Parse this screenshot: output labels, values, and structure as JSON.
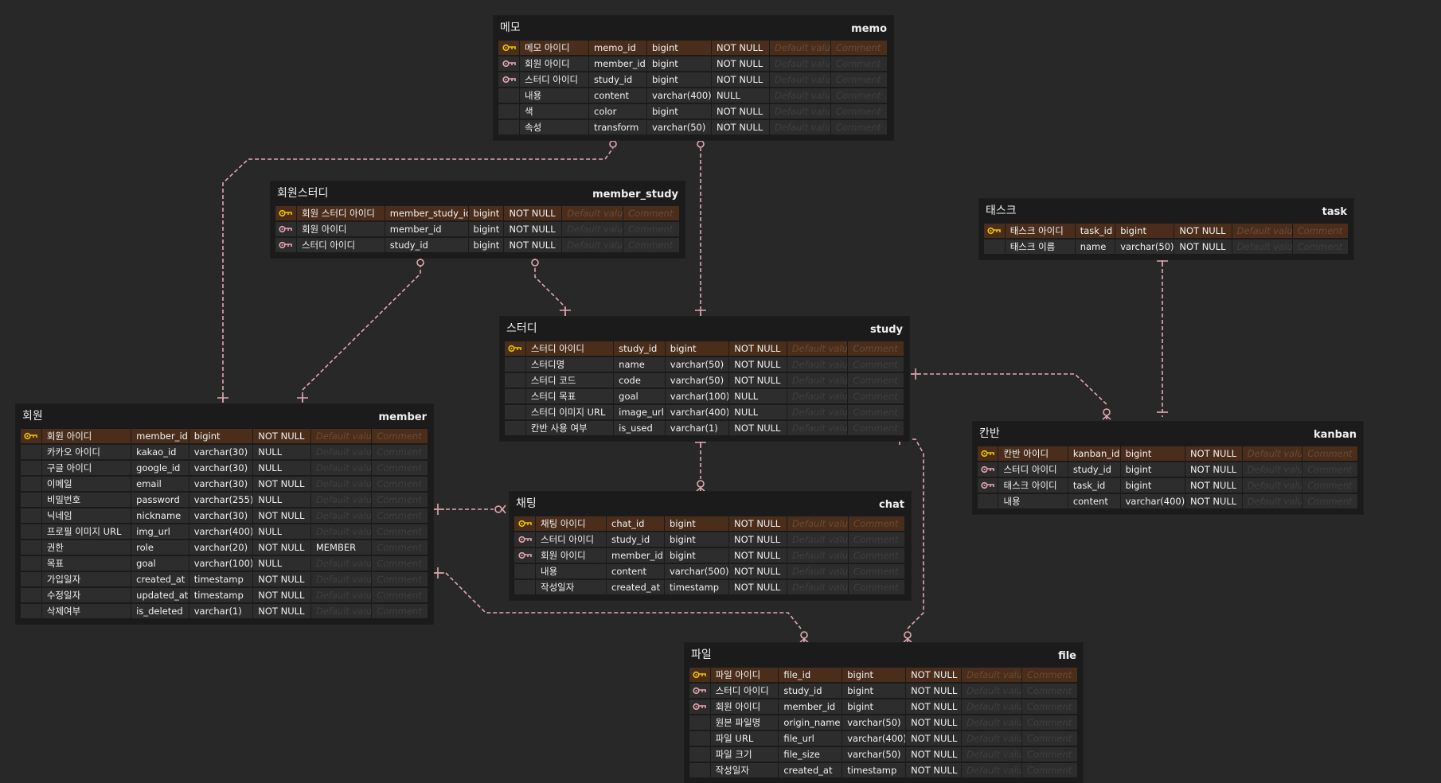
{
  "colors": {
    "background": "#282828",
    "table_bg": "#1b1b1b",
    "cell_bg": "#2d2d2d",
    "pk_row_bg": "#4a2e1b",
    "pk_key": "#f0c400",
    "fk_key": "#e8a5b4",
    "relation_line": "#e0a9b2"
  },
  "placeholders": {
    "default_value": "Default value",
    "comment": "Comment"
  },
  "tables": {
    "memo": {
      "logical": "메모",
      "physical": "memo",
      "columns": [
        {
          "key": "pk",
          "logical": "메모 아이디",
          "physical": "memo_id",
          "type": "bigint",
          "nullable": "NOT NULL",
          "default": "",
          "comment": ""
        },
        {
          "key": "fk",
          "logical": "회원 아이디",
          "physical": "member_id",
          "type": "bigint",
          "nullable": "NOT NULL",
          "default": "",
          "comment": ""
        },
        {
          "key": "fk",
          "logical": "스터디 아이디",
          "physical": "study_id",
          "type": "bigint",
          "nullable": "NOT NULL",
          "default": "",
          "comment": ""
        },
        {
          "key": "",
          "logical": "내용",
          "physical": "content",
          "type": "varchar(400)",
          "nullable": "NULL",
          "default": "",
          "comment": ""
        },
        {
          "key": "",
          "logical": "색",
          "physical": "color",
          "type": "bigint",
          "nullable": "NOT NULL",
          "default": "",
          "comment": ""
        },
        {
          "key": "",
          "logical": "속성",
          "physical": "transform",
          "type": "varchar(50)",
          "nullable": "NOT NULL",
          "default": "",
          "comment": ""
        }
      ]
    },
    "member_study": {
      "logical": "회원스터디",
      "physical": "member_study",
      "columns": [
        {
          "key": "pk",
          "logical": "회원 스터디 아이디",
          "physical": "member_study_id",
          "type": "bigint",
          "nullable": "NOT NULL",
          "default": "",
          "comment": ""
        },
        {
          "key": "fk",
          "logical": "회원 아이디",
          "physical": "member_id",
          "type": "bigint",
          "nullable": "NOT NULL",
          "default": "",
          "comment": ""
        },
        {
          "key": "fk",
          "logical": "스터디 아이디",
          "physical": "study_id",
          "type": "bigint",
          "nullable": "NOT NULL",
          "default": "",
          "comment": ""
        }
      ]
    },
    "study": {
      "logical": "스터디",
      "physical": "study",
      "columns": [
        {
          "key": "pk",
          "logical": "스터디 아이디",
          "physical": "study_id",
          "type": "bigint",
          "nullable": "NOT NULL",
          "default": "",
          "comment": ""
        },
        {
          "key": "",
          "logical": "스터디명",
          "physical": "name",
          "type": "varchar(50)",
          "nullable": "NOT NULL",
          "default": "",
          "comment": ""
        },
        {
          "key": "",
          "logical": "스터디 코드",
          "physical": "code",
          "type": "varchar(50)",
          "nullable": "NOT NULL",
          "default": "",
          "comment": ""
        },
        {
          "key": "",
          "logical": "스터디 목표",
          "physical": "goal",
          "type": "varchar(100)",
          "nullable": "NULL",
          "default": "",
          "comment": ""
        },
        {
          "key": "",
          "logical": "스터디 이미지 URL",
          "physical": "image_url",
          "type": "varchar(400)",
          "nullable": "NULL",
          "default": "",
          "comment": ""
        },
        {
          "key": "",
          "logical": "칸반 사용 여부",
          "physical": "is_used",
          "type": "varchar(1)",
          "nullable": "NOT NULL",
          "default": "",
          "comment": ""
        }
      ]
    },
    "member": {
      "logical": "회원",
      "physical": "member",
      "columns": [
        {
          "key": "pk",
          "logical": "회원 아이디",
          "physical": "member_id",
          "type": "bigint",
          "nullable": "NOT NULL",
          "default": "",
          "comment": ""
        },
        {
          "key": "",
          "logical": "카카오 아이디",
          "physical": "kakao_id",
          "type": "varchar(30)",
          "nullable": "NULL",
          "default": "",
          "comment": ""
        },
        {
          "key": "",
          "logical": "구글 아이디",
          "physical": "google_id",
          "type": "varchar(30)",
          "nullable": "NULL",
          "default": "",
          "comment": ""
        },
        {
          "key": "",
          "logical": "이메일",
          "physical": "email",
          "type": "varchar(30)",
          "nullable": "NOT NULL",
          "default": "",
          "comment": ""
        },
        {
          "key": "",
          "logical": "비밀번호",
          "physical": "password",
          "type": "varchar(255)",
          "nullable": "NULL",
          "default": "",
          "comment": ""
        },
        {
          "key": "",
          "logical": "닉네임",
          "physical": "nickname",
          "type": "varchar(30)",
          "nullable": "NOT NULL",
          "default": "",
          "comment": ""
        },
        {
          "key": "",
          "logical": "프로필 이미지 URL",
          "physical": "img_url",
          "type": "varchar(400)",
          "nullable": "NULL",
          "default": "",
          "comment": ""
        },
        {
          "key": "",
          "logical": "권한",
          "physical": "role",
          "type": "varchar(20)",
          "nullable": "NOT NULL",
          "default": "MEMBER",
          "comment": ""
        },
        {
          "key": "",
          "logical": "목표",
          "physical": "goal",
          "type": "varchar(100)",
          "nullable": "NULL",
          "default": "",
          "comment": ""
        },
        {
          "key": "",
          "logical": "가입일자",
          "physical": "created_at",
          "type": "timestamp",
          "nullable": "NOT NULL",
          "default": "",
          "comment": ""
        },
        {
          "key": "",
          "logical": "수정일자",
          "physical": "updated_at",
          "type": "timestamp",
          "nullable": "NOT NULL",
          "default": "",
          "comment": ""
        },
        {
          "key": "",
          "logical": "삭제여부",
          "physical": "is_deleted",
          "type": "varchar(1)",
          "nullable": "NOT NULL",
          "default": "",
          "comment": ""
        }
      ]
    },
    "chat": {
      "logical": "채팅",
      "physical": "chat",
      "columns": [
        {
          "key": "pk",
          "logical": "채팅 아이디",
          "physical": "chat_id",
          "type": "bigint",
          "nullable": "NOT NULL",
          "default": "",
          "comment": ""
        },
        {
          "key": "fk",
          "logical": "스터디 아이디",
          "physical": "study_id",
          "type": "bigint",
          "nullable": "NOT NULL",
          "default": "",
          "comment": ""
        },
        {
          "key": "fk",
          "logical": "회원 아이디",
          "physical": "member_id",
          "type": "bigint",
          "nullable": "NOT NULL",
          "default": "",
          "comment": ""
        },
        {
          "key": "",
          "logical": "내용",
          "physical": "content",
          "type": "varchar(500)",
          "nullable": "NOT NULL",
          "default": "",
          "comment": ""
        },
        {
          "key": "",
          "logical": "작성일자",
          "physical": "created_at",
          "type": "timestamp",
          "nullable": "NOT NULL",
          "default": "",
          "comment": ""
        }
      ]
    },
    "file": {
      "logical": "파일",
      "physical": "file",
      "columns": [
        {
          "key": "pk",
          "logical": "파일 아이디",
          "physical": "file_id",
          "type": "bigint",
          "nullable": "NOT NULL",
          "default": "",
          "comment": ""
        },
        {
          "key": "fk",
          "logical": "스터디 아이디",
          "physical": "study_id",
          "type": "bigint",
          "nullable": "NOT NULL",
          "default": "",
          "comment": ""
        },
        {
          "key": "fk",
          "logical": "회원 아이디",
          "physical": "member_id",
          "type": "bigint",
          "nullable": "NOT NULL",
          "default": "",
          "comment": ""
        },
        {
          "key": "",
          "logical": "원본 파일명",
          "physical": "origin_name",
          "type": "varchar(50)",
          "nullable": "NOT NULL",
          "default": "",
          "comment": ""
        },
        {
          "key": "",
          "logical": "파일 URL",
          "physical": "file_url",
          "type": "varchar(400)",
          "nullable": "NOT NULL",
          "default": "",
          "comment": ""
        },
        {
          "key": "",
          "logical": "파일 크기",
          "physical": "file_size",
          "type": "varchar(50)",
          "nullable": "NOT NULL",
          "default": "",
          "comment": ""
        },
        {
          "key": "",
          "logical": "작성일자",
          "physical": "created_at",
          "type": "timestamp",
          "nullable": "NOT NULL",
          "default": "",
          "comment": ""
        }
      ]
    },
    "task": {
      "logical": "태스크",
      "physical": "task",
      "columns": [
        {
          "key": "pk",
          "logical": "태스크 아이디",
          "physical": "task_id",
          "type": "bigint",
          "nullable": "NOT NULL",
          "default": "",
          "comment": ""
        },
        {
          "key": "",
          "logical": "태스크 이름",
          "physical": "name",
          "type": "varchar(50)",
          "nullable": "NOT NULL",
          "default": "",
          "comment": ""
        }
      ]
    },
    "kanban": {
      "logical": "칸반",
      "physical": "kanban",
      "columns": [
        {
          "key": "pk",
          "logical": "칸반 아이디",
          "physical": "kanban_id",
          "type": "bigint",
          "nullable": "NOT NULL",
          "default": "",
          "comment": ""
        },
        {
          "key": "fk",
          "logical": "스터디 아이디",
          "physical": "study_id",
          "type": "bigint",
          "nullable": "NOT NULL",
          "default": "",
          "comment": ""
        },
        {
          "key": "fk",
          "logical": "태스크 아이디",
          "physical": "task_id",
          "type": "bigint",
          "nullable": "NOT NULL",
          "default": "",
          "comment": ""
        },
        {
          "key": "",
          "logical": "내용",
          "physical": "content",
          "type": "varchar(400)",
          "nullable": "NOT NULL",
          "default": "",
          "comment": ""
        }
      ]
    }
  },
  "relationships": [
    {
      "from": "member",
      "to": "memo",
      "type": "one-to-zero-or-many"
    },
    {
      "from": "study",
      "to": "memo",
      "type": "one-to-zero-or-many"
    },
    {
      "from": "member",
      "to": "member_study",
      "type": "one-to-zero-or-many"
    },
    {
      "from": "study",
      "to": "member_study",
      "type": "one-to-zero-or-many"
    },
    {
      "from": "member",
      "to": "chat",
      "type": "one-to-zero-or-many"
    },
    {
      "from": "study",
      "to": "chat",
      "type": "one-to-zero-or-many"
    },
    {
      "from": "member",
      "to": "file",
      "type": "one-to-zero-or-many"
    },
    {
      "from": "study",
      "to": "file",
      "type": "one-to-zero-or-many"
    },
    {
      "from": "study",
      "to": "kanban",
      "type": "one-to-zero-or-many"
    },
    {
      "from": "task",
      "to": "kanban",
      "type": "one-to-zero-or-many"
    }
  ]
}
